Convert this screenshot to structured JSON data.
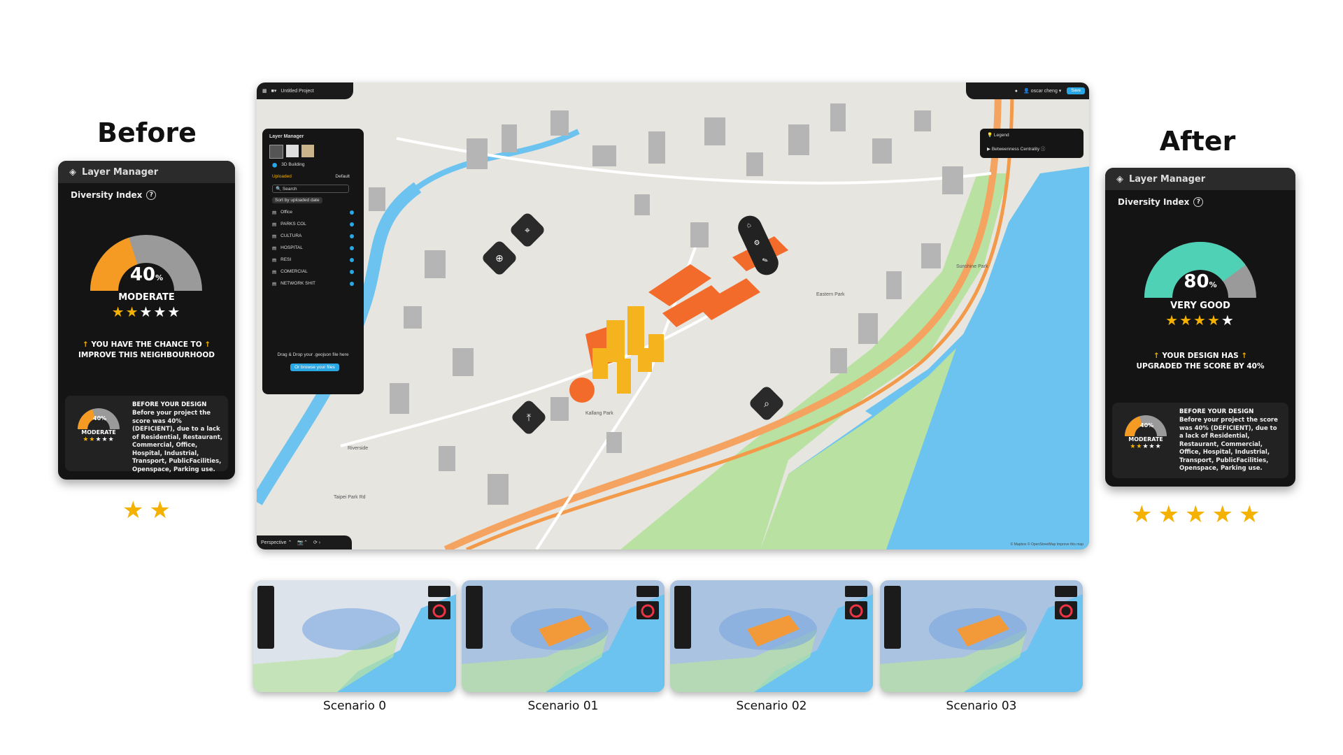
{
  "before": {
    "heading": "Before",
    "panel_title": "Layer Manager",
    "index_title": "Diversity Index",
    "percent": "40",
    "percent_unit": "%",
    "score_fraction": 0.4,
    "rating": "MODERATE",
    "stars_filled": 2,
    "stars_total": 5,
    "message_line1": "YOU HAVE THE CHANCE TO",
    "message_line2": "IMPROVE THIS NEIGHBOURHOOD",
    "detail_title": "BEFORE YOUR DESIGN",
    "detail_body": "Before your project the score was 40% (DEFICIENT), due to a lack of Residential, Restaurant, Commercial, Office, Hospital, Industrial, Transport, PublicFacilities, Openspace, Parking use.",
    "detail_percent": "40%",
    "detail_rating": "MODERATE",
    "below_stars": 2,
    "gauge_color": "#f59a23"
  },
  "after": {
    "heading": "After",
    "panel_title": "Layer Manager",
    "index_title": "Diversity Index",
    "percent": "80",
    "percent_unit": "%",
    "score_fraction": 0.8,
    "rating": "VERY GOOD",
    "stars_filled": 4,
    "stars_total": 5,
    "message_line1": "YOUR DESIGN HAS",
    "message_line2": "UPGRADED THE SCORE BY 40%",
    "detail_title": "BEFORE YOUR DESIGN",
    "detail_body": "Before your project the score was 40% (DEFICIENT), due to a lack of Residential, Restaurant, Commercial, Office, Hospital, Industrial, Transport, PublicFacilities, Openspace, Parking use.",
    "detail_percent": "40%",
    "detail_rating": "MODERATE",
    "below_stars": 5,
    "gauge_color": "#4fd1b5"
  },
  "map": {
    "project_name": "Untitled Project",
    "user_name": "oscar cheng",
    "save_label": "Save",
    "layer_manager_title": "Layer Manager",
    "building_toggle": "3D Building",
    "tab_uploaded": "Uploaded",
    "tab_default": "Default",
    "search_placeholder": "Search",
    "sort_label": "Sort by uploaded date",
    "layers": [
      "Office",
      "PARKS COL",
      "CULTURA",
      "HOSPITAL",
      "RESI",
      "COMERCIAL",
      "NETWORK SHIT"
    ],
    "drop_text": "Drag & Drop your .geojson file here",
    "browse_label": "Or browse your files",
    "legend_title": "Legend",
    "legend_item": "Betweenness Centrality",
    "view_mode": "Perspective",
    "attribution": "© Mapbox © OpenStreetMap  Improve this map",
    "street_labels": [
      "Kallang Park",
      "Riverside",
      "Eastern Park",
      "Taipei Park Rd",
      "Sunshine Park"
    ]
  },
  "scenarios": [
    "Scenario 0",
    "Scenario 01",
    "Scenario 02",
    "Scenario 03"
  ]
}
